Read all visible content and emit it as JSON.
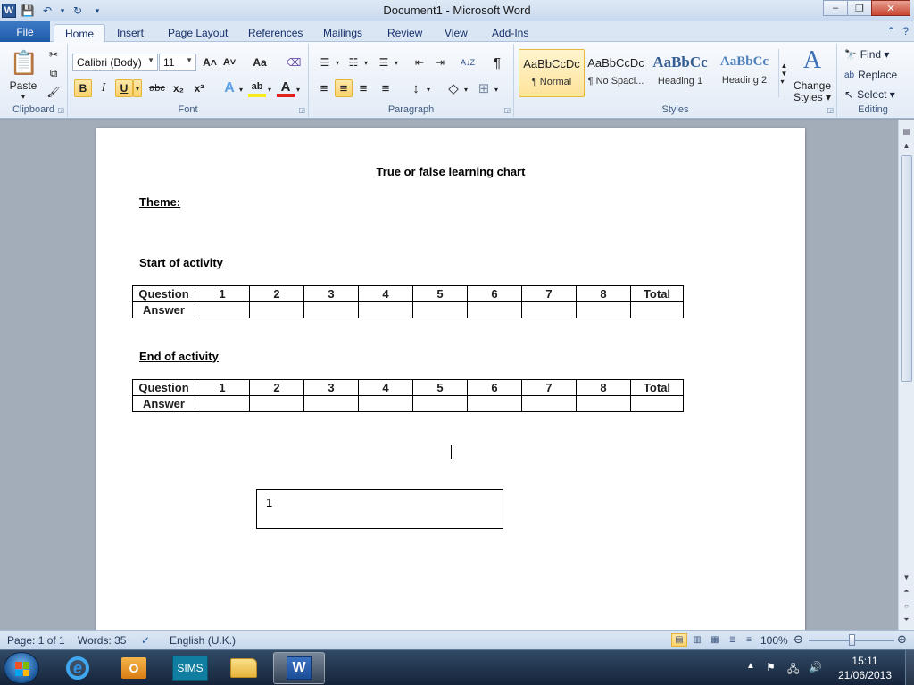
{
  "window": {
    "title": "Document1 - Microsoft Word",
    "app_logo": "W"
  },
  "qat": {
    "icons": [
      "save-icon",
      "undo-icon",
      "redo-icon",
      "customize-icon"
    ],
    "glyphs": {
      "save": "💾",
      "undo": "↶",
      "undo_drop": "▾",
      "redo": "↻",
      "customize": "▾"
    }
  },
  "window_controls": {
    "minimize": "–",
    "maximize": "❐",
    "close": "✕"
  },
  "tabs": {
    "file": "File",
    "items": [
      "Home",
      "Insert",
      "Page Layout",
      "References",
      "Mailings",
      "Review",
      "View",
      "Add-Ins"
    ],
    "active": "Home",
    "help_glyph": "?",
    "collapse_glyph": "⌃"
  },
  "ribbon": {
    "clipboard": {
      "label": "Clipboard",
      "paste": "Paste",
      "paste_glyph": "📋",
      "cut_glyph": "✂",
      "copy_glyph": "⧉",
      "format_painter_glyph": "🖌"
    },
    "font": {
      "label": "Font",
      "font_name": "Calibri (Body)",
      "font_size": "11",
      "grow": "A˄",
      "shrink": "A˅",
      "change_case": "Aa",
      "clear_format": "⌫",
      "bold": "B",
      "italic": "I",
      "underline": "U",
      "strike": "abc",
      "subscript": "x₂",
      "superscript": "x²",
      "text_effects": "A",
      "highlight": "ab",
      "font_color": "A"
    },
    "paragraph": {
      "label": "Paragraph",
      "bullets": "☰",
      "numbering": "☷",
      "multilevel": "☰",
      "decrease_indent": "⇤",
      "increase_indent": "⇥",
      "sort": "A↓Z",
      "show_marks": "¶",
      "align_left": "≡",
      "center": "≡",
      "align_right": "≡",
      "justify": "≡",
      "line_spacing": "↕",
      "shading": "◇",
      "borders": "⊞"
    },
    "styles": {
      "label": "Styles",
      "items": [
        {
          "sample": "AaBbCcDc",
          "name": "¶ Normal"
        },
        {
          "sample": "AaBbCcDc",
          "name": "¶ No Spaci..."
        },
        {
          "sample": "AaBbCc",
          "name": "Heading 1"
        },
        {
          "sample": "AaBbCc",
          "name": "Heading 2"
        }
      ],
      "change_styles_line1": "Change",
      "change_styles_line2": "Styles ▾",
      "change_styles_glyph": "A"
    },
    "editing": {
      "label": "Editing",
      "find": "Find ▾",
      "replace": "Replace",
      "select": "Select ▾",
      "find_glyph": "🔭",
      "replace_glyph": "ab",
      "select_glyph": "↖"
    }
  },
  "document": {
    "title": "True or false learning chart",
    "theme_label": "Theme:",
    "start_heading": "Start of activity",
    "end_heading": "End of activity",
    "table_header": [
      "Question",
      "1",
      "2",
      "3",
      "4",
      "5",
      "6",
      "7",
      "8",
      "Total"
    ],
    "answer_label": "Answer",
    "textbox_text": "1"
  },
  "statusbar": {
    "page": "Page: 1 of 1",
    "words": "Words: 35",
    "language": "English (U.K.)",
    "zoom": "100%",
    "zoom_level_percent": 100,
    "proofing_glyph": "✓"
  },
  "taskbar": {
    "apps": [
      "internet-explorer",
      "outlook",
      "sims",
      "file-explorer",
      "microsoft-word"
    ],
    "sims_label": "SIMS",
    "outlook_label": "O",
    "ie_label": "e",
    "word_label": "W",
    "tray_glyphs": {
      "arrow": "▲",
      "flag": "⚑",
      "network": "🖧",
      "volume": "🔊"
    },
    "time": "15:11",
    "date": "21/06/2013"
  },
  "colors": {
    "file_tab": "#2b5797",
    "selected": "#fbd26b",
    "taskbar": "#1c2d45"
  }
}
